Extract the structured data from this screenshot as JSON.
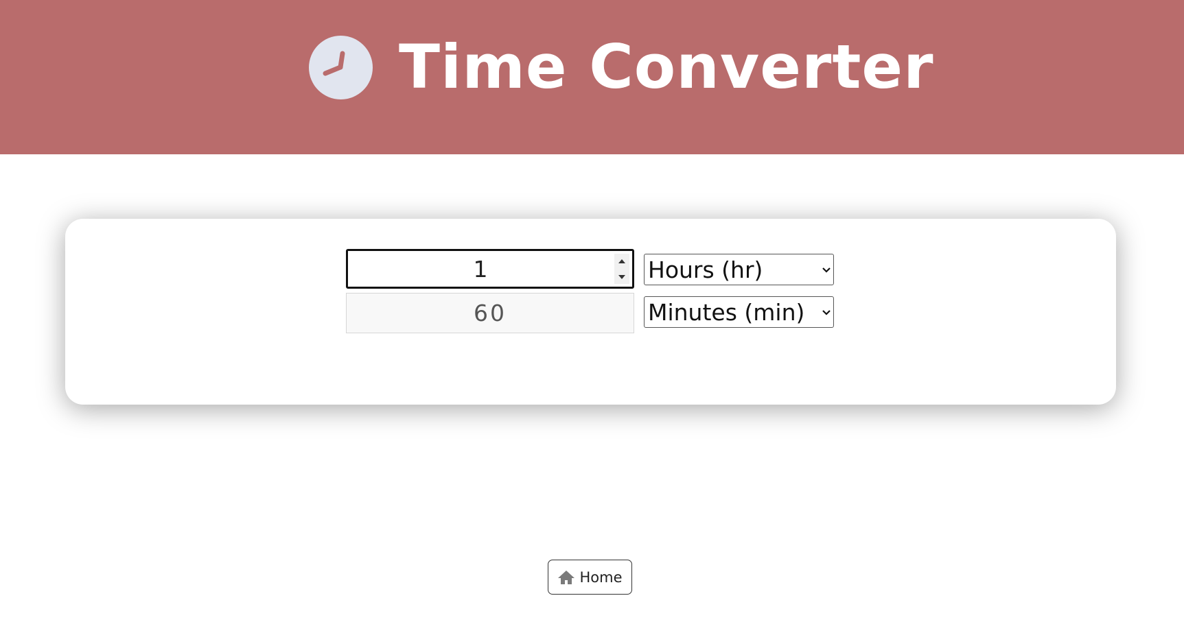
{
  "header": {
    "title": "Time Converter",
    "icon": "clock-icon",
    "background": "#b96c6c"
  },
  "converter": {
    "input_value": "1",
    "output_value": "60",
    "from_unit": "Hours (hr)",
    "to_unit": "Minutes (min)"
  },
  "footer": {
    "home_label": "Home",
    "home_icon": "home-icon"
  }
}
